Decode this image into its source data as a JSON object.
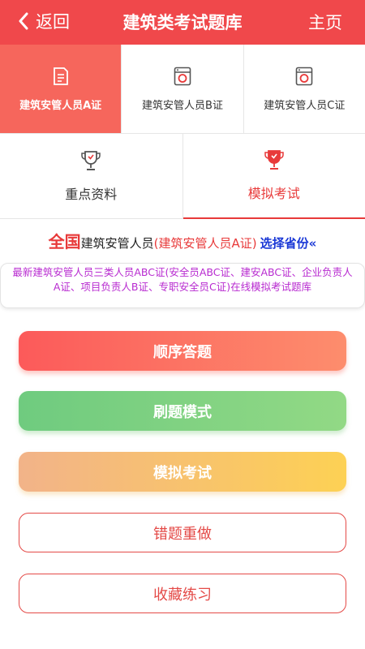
{
  "header": {
    "back_label": "返回",
    "title": "建筑类考试题库",
    "home_label": "主页",
    "bg_color": "#f0484b"
  },
  "cert_tabs": [
    {
      "label": "建筑安管人员A证",
      "icon": "document-icon",
      "active": true
    },
    {
      "label": "建筑安管人员B证",
      "icon": "washing-machine-icon",
      "active": false
    },
    {
      "label": "建筑安管人员C证",
      "icon": "washing-machine-icon",
      "active": false
    }
  ],
  "tools": [
    {
      "label": "重点资料",
      "icon": "trophy-icon",
      "active": false
    },
    {
      "label": "模拟考试",
      "icon": "trophy-icon",
      "active": true
    }
  ],
  "info": {
    "nation": "全国",
    "group": "建筑安管人员",
    "cert": "(建筑安管人员A证)",
    "choose": "选择省份«"
  },
  "notice": "最新建筑安管人员三类人员ABC证(安全员ABC证、建安ABC证、企业负责人A证、项目负责人B证、专职安全员C证)在线模拟考试题库",
  "buttons": {
    "sequence": "顺序答题",
    "practice": "刷题模式",
    "mock": "模拟考试",
    "wrong": "错题重做",
    "favorites": "收藏练习"
  },
  "colors": {
    "accent": "#e83a3a",
    "link": "#1a38d6",
    "notice": "#b82bd0"
  }
}
